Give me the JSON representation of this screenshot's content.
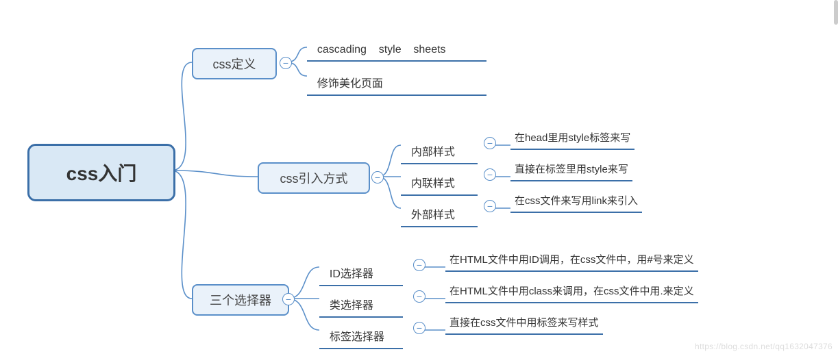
{
  "root": {
    "title": "css入门"
  },
  "branches": [
    {
      "label": "css定义",
      "children": [
        {
          "label": "cascading    style    sheets",
          "detail": null
        },
        {
          "label": "修饰美化页面",
          "detail": null
        }
      ]
    },
    {
      "label": "css引入方式",
      "children": [
        {
          "label": "内部样式",
          "detail": "在head里用style标签来写"
        },
        {
          "label": "内联样式",
          "detail": "直接在标签里用style来写"
        },
        {
          "label": "外部样式",
          "detail": "在css文件来写用link来引入"
        }
      ]
    },
    {
      "label": "三个选择器",
      "children": [
        {
          "label": "ID选择器",
          "detail": "在HTML文件中用ID调用，在css文件中，用#号来定义"
        },
        {
          "label": "类选择器",
          "detail": "在HTML文件中用class来调用，在css文件中用.来定义"
        },
        {
          "label": "标签选择器",
          "detail": "直接在css文件中用标签来写样式"
        }
      ]
    }
  ],
  "collapse_glyph": "−",
  "watermark": "https://blog.csdn.net/qq1632047376"
}
